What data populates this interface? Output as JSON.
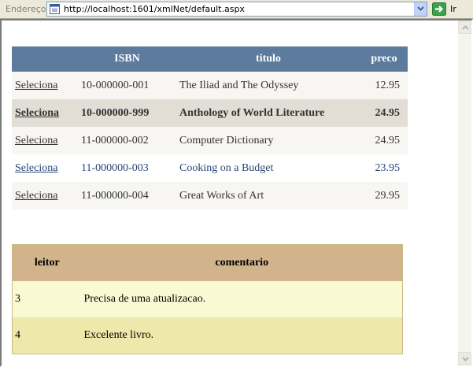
{
  "address_bar": {
    "label": "Endereço",
    "url": "http://localhost:1601/xmlNet/default.aspx",
    "go_label": "Ir"
  },
  "books": {
    "headers": {
      "select": "",
      "isbn": "ISBN",
      "titulo": "titulo",
      "preco": "preco"
    },
    "rows": [
      {
        "select": "Seleciona",
        "isbn": "10-000000-001",
        "titulo": "The Iliad and The Odyssey",
        "preco": "12.95"
      },
      {
        "select": "Seleciona",
        "isbn": "10-000000-999",
        "titulo": "Anthology of World Literature",
        "preco": "24.95"
      },
      {
        "select": "Seleciona",
        "isbn": "11-000000-002",
        "titulo": "Computer Dictionary",
        "preco": "24.95"
      },
      {
        "select": "Seleciona",
        "isbn": "11-000000-003",
        "titulo": "Cooking on a Budget",
        "preco": "23.95"
      },
      {
        "select": "Seleciona",
        "isbn": "11-000000-004",
        "titulo": "Great Works of Art",
        "preco": "29.95"
      }
    ],
    "selected_row": 1,
    "colors": {
      "header": "#5d7b9d",
      "row": "#f7f6f3",
      "alt_row": "#ffffff",
      "selected": "#e2ded6",
      "alt_text": "#284775"
    }
  },
  "comments": {
    "headers": {
      "leitor": "leitor",
      "comentario": "comentario"
    },
    "rows": [
      {
        "leitor": "3",
        "comentario": "Precisa de uma atualizacao."
      },
      {
        "leitor": "4",
        "comentario": "Excelente livro."
      }
    ],
    "colors": {
      "header": "#d2b48c",
      "row": "#fafad2",
      "alt_row": "#eee8aa"
    }
  }
}
